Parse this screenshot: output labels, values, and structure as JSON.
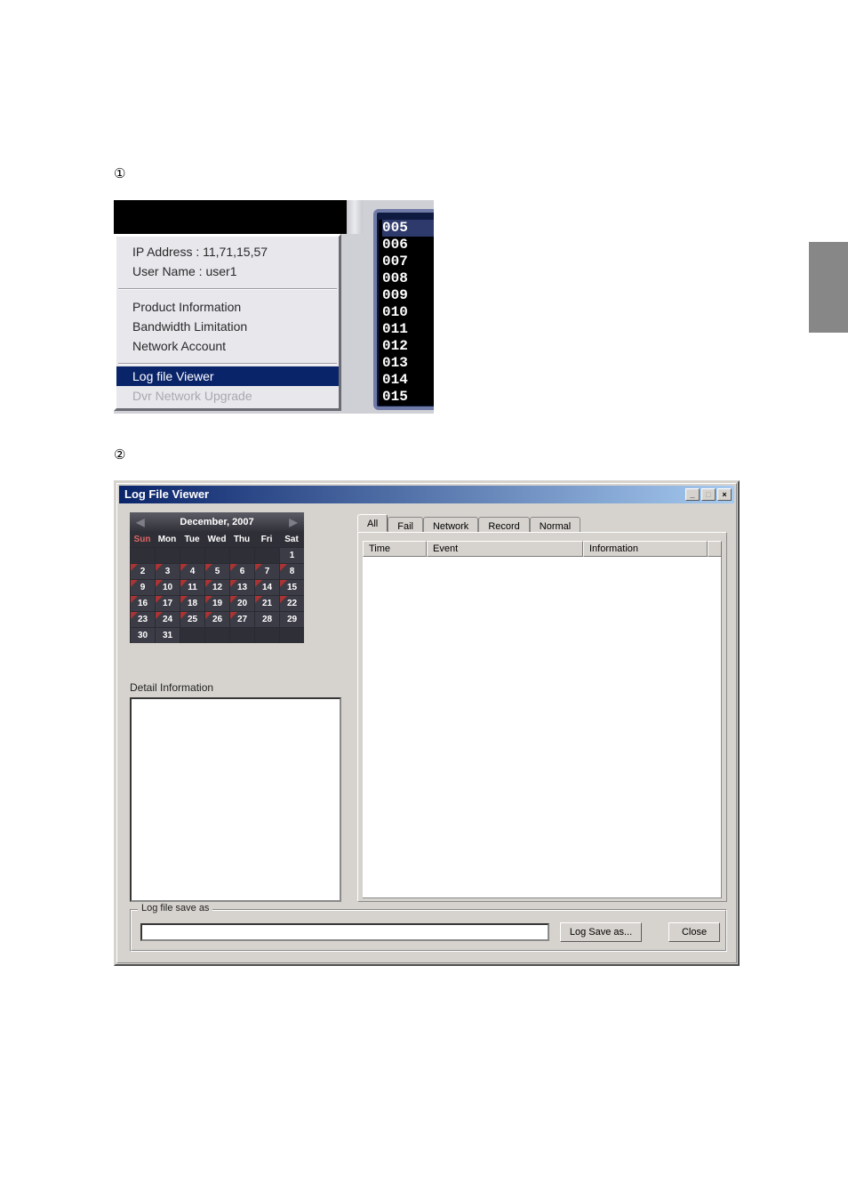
{
  "labels": {
    "one": "①",
    "two": "②"
  },
  "menu": {
    "ip_line": "IP Address : 11,71,15,57",
    "user_line": "User Name : user1",
    "product_info": "Product Information",
    "bandwidth": "Bandwidth Limitation",
    "network_account": "Network Account",
    "log_file_viewer": "Log file Viewer",
    "dvr_upgrade": "Dvr Network Upgrade"
  },
  "channels": {
    "items": [
      "005",
      "006",
      "007",
      "008",
      "009",
      "010",
      "011",
      "012",
      "013",
      "014",
      "015"
    ],
    "up_glyph": "▲"
  },
  "dialog": {
    "title": "Log File Viewer",
    "min_glyph": "_",
    "max_glyph": "□",
    "close_glyph": "×"
  },
  "calendar": {
    "title": "December, 2007",
    "prev": "◀",
    "next": "▶",
    "dow": [
      "Sun",
      "Mon",
      "Tue",
      "Wed",
      "Thu",
      "Fri",
      "Sat"
    ]
  },
  "detail_label": "Detail Information",
  "tabs": {
    "all": "All",
    "fail": "Fail",
    "network": "Network",
    "record": "Record",
    "normal": "Normal"
  },
  "columns": {
    "time": "Time",
    "event": "Event",
    "info": "Information"
  },
  "group": {
    "label": "Log file save as",
    "save_btn": "Log Save as...",
    "close_btn": "Close"
  }
}
